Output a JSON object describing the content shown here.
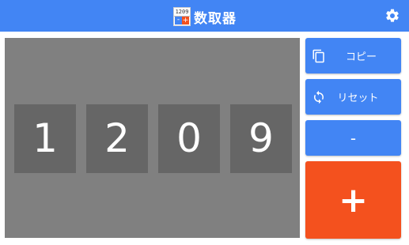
{
  "app": {
    "title": "数取器",
    "icon_number": "1209",
    "icon_minus": "-",
    "icon_plus": "+"
  },
  "counter": {
    "digits": [
      "1",
      "2",
      "0",
      "9"
    ]
  },
  "buttons": {
    "copy_label": "コピー",
    "reset_label": "リセット",
    "minus_label": "-",
    "plus_label": "+"
  },
  "colors": {
    "app_bar": "#4285f4",
    "primary_button": "#4285f4",
    "increment_button": "#f4511e",
    "counter_panel": "#808080",
    "digit_tile": "#666666"
  },
  "icons": {
    "settings": "gear-icon",
    "copy": "copy-icon",
    "reset": "refresh-icon"
  }
}
